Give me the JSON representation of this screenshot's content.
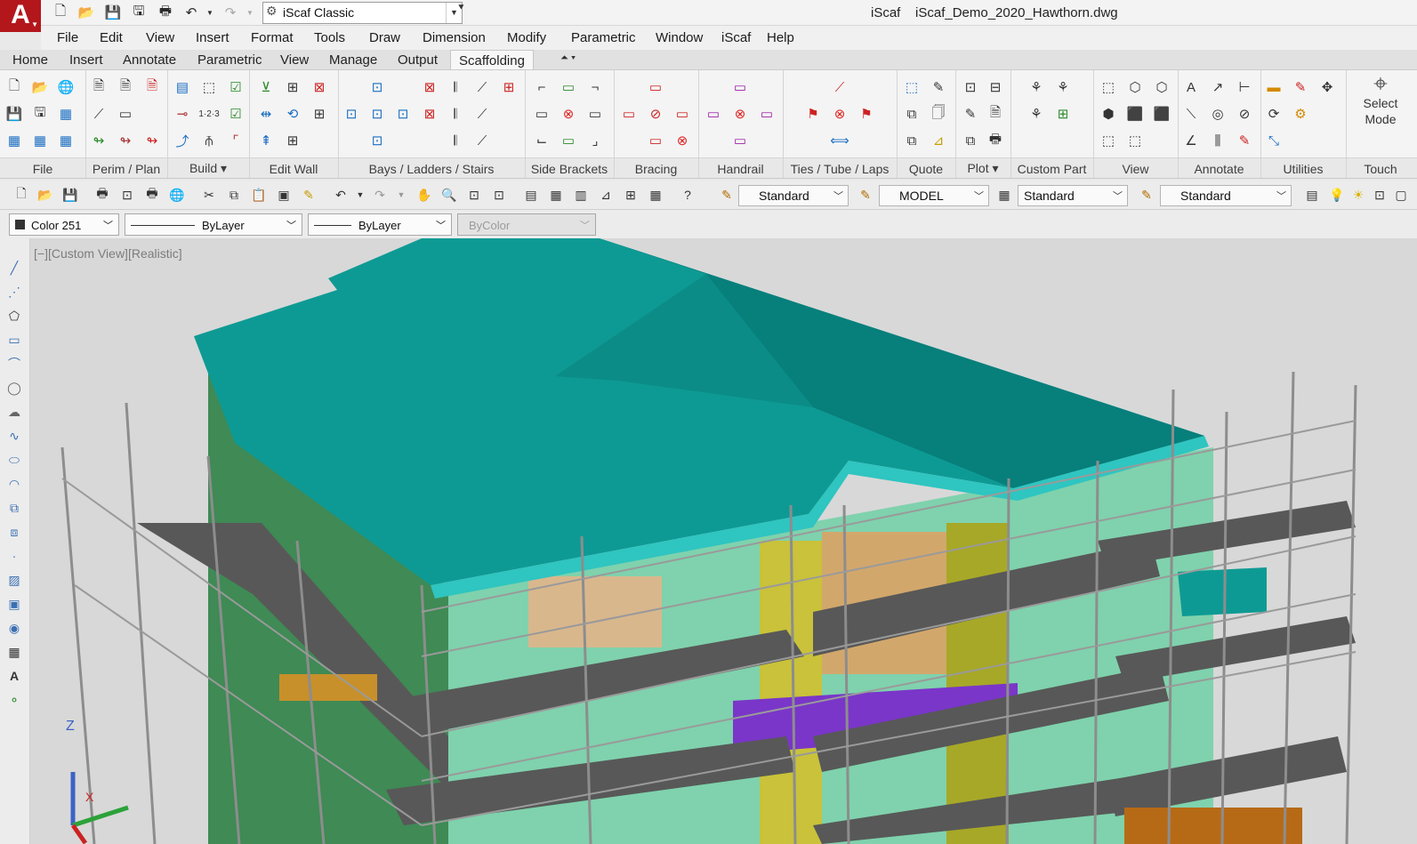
{
  "app": {
    "logo_letter": "A",
    "workspace": "iScaf Classic",
    "title": "iScaf    iScaf_Demo_2020_Hawthorn.dwg"
  },
  "menu": [
    "File",
    "Edit",
    "View",
    "Insert",
    "Format",
    "Tools",
    "Draw",
    "Dimension",
    "Modify",
    "Parametric",
    "Window",
    "iScaf",
    "Help"
  ],
  "ribbon_tabs": [
    "Home",
    "Insert",
    "Annotate",
    "Parametric",
    "View",
    "Manage",
    "Output",
    "Scaffolding"
  ],
  "active_tab": "Scaffolding",
  "panels": [
    "File",
    "Perim / Plan",
    "Build",
    "Edit Wall",
    "Bays /  Ladders / Stairs",
    "Side Brackets",
    "Bracing",
    "Handrail",
    "Ties / Tube / Laps",
    "Quote",
    "Plot",
    "Custom Part",
    "View",
    "Annotate",
    "Utilities"
  ],
  "select_mode": {
    "line1": "Select",
    "line2": "Mode",
    "touch": "Touch"
  },
  "toolbar": {
    "text_style": "Standard",
    "layout": "MODEL",
    "dim_style": "Standard",
    "table_style": "Standard"
  },
  "properties": {
    "color": "Color 251",
    "linetype": "ByLayer",
    "lineweight": "ByLayer",
    "plotstyle": "ByColor"
  },
  "viewport": {
    "label": "[−][Custom View][Realistic]"
  },
  "ucs": {
    "z": "Z",
    "x": "X"
  },
  "colors": {
    "roof": "#0e9a94",
    "roof_dark": "#077f7b",
    "wall_green": "#3f8a55",
    "wall_mint": "#7fd2ad",
    "deck": "#585858",
    "scaffold": "#8d8d8d",
    "accent_yellow": "#c9c23a",
    "purple": "#7a36c9"
  }
}
